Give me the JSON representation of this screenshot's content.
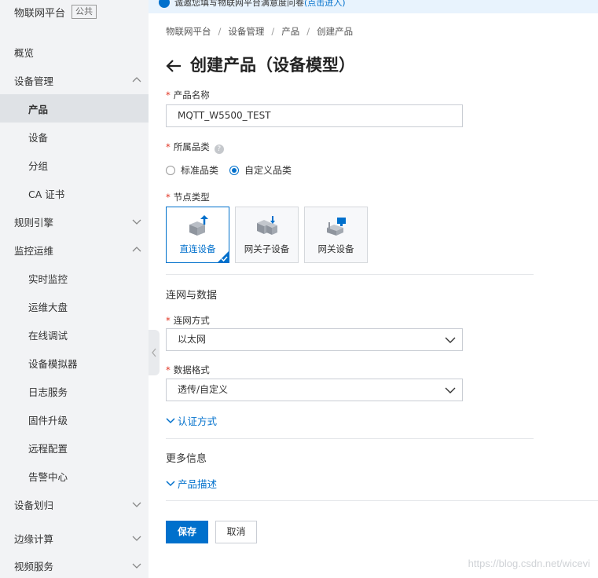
{
  "sidebar": {
    "platform_title": "物联网平台",
    "platform_tag": "公共",
    "items": [
      {
        "label": "概览"
      },
      {
        "label": "设备管理"
      },
      {
        "label": "产品"
      },
      {
        "label": "设备"
      },
      {
        "label": "分组"
      },
      {
        "label": "CA 证书"
      },
      {
        "label": "规则引擎"
      },
      {
        "label": "监控运维"
      },
      {
        "label": "实时监控"
      },
      {
        "label": "运维大盘"
      },
      {
        "label": "在线调试"
      },
      {
        "label": "设备模拟器"
      },
      {
        "label": "日志服务"
      },
      {
        "label": "固件升级"
      },
      {
        "label": "远程配置"
      },
      {
        "label": "告警中心"
      },
      {
        "label": "设备划归"
      },
      {
        "label": "边缘计算"
      },
      {
        "label": "视频服务"
      }
    ]
  },
  "banner": {
    "text": "诚邀您填写物联网平台满意度问卷",
    "link": "(点击进入)"
  },
  "breadcrumb": [
    "物联网平台",
    "设备管理",
    "产品",
    "创建产品"
  ],
  "page_title": "创建产品（设备模型）",
  "form": {
    "product_name_label": "产品名称",
    "product_name_value": "MQTT_W5500_TEST",
    "category_label": "所属品类",
    "category_options": [
      "标准品类",
      "自定义品类"
    ],
    "category_selected": "自定义品类",
    "node_type_label": "节点类型",
    "node_types": [
      {
        "label": "直连设备",
        "selected": true
      },
      {
        "label": "网关子设备",
        "selected": false
      },
      {
        "label": "网关设备",
        "selected": false
      }
    ],
    "network_section_title": "连网与数据",
    "network_method_label": "连网方式",
    "network_method_value": "以太网",
    "data_format_label": "数据格式",
    "data_format_value": "透传/自定义",
    "auth_expander": "认证方式",
    "more_info_title": "更多信息",
    "description_expander": "产品描述"
  },
  "buttons": {
    "save": "保存",
    "cancel": "取消"
  },
  "watermark": "https://blog.csdn.net/wicevi",
  "colors": {
    "accent": "#0070cc",
    "required": "#e0301e",
    "sidebar_bg": "#f2f3f5",
    "sidebar_active": "#dfe2e6"
  }
}
